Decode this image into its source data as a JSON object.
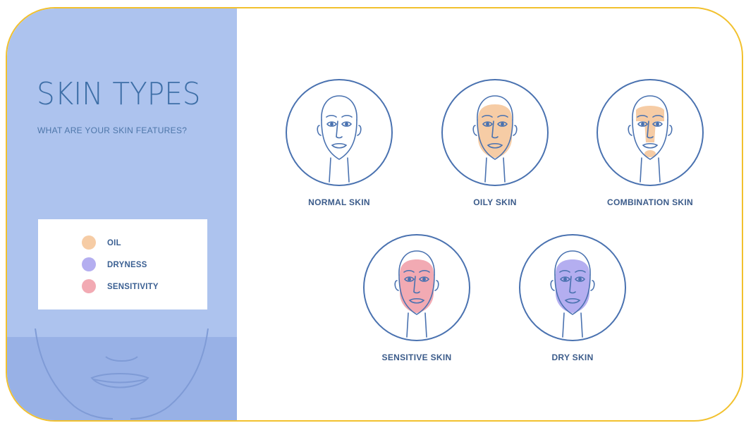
{
  "header": {
    "title": "SKIN TYPES",
    "subtitle": "WHAT ARE YOUR SKIN FEATURES?"
  },
  "legend": {
    "items": [
      {
        "label": "OIL",
        "color": "#f6cca5"
      },
      {
        "label": "DRYNESS",
        "color": "#b4aef0"
      },
      {
        "label": "SENSITIVITY",
        "color": "#f2aab3"
      }
    ]
  },
  "colors": {
    "panel": "#adc3ee",
    "accent_line": "#4a72b0",
    "frame_border": "#f2c12e"
  },
  "faces": [
    {
      "id": "normal",
      "label": "NORMAL SKIN",
      "icon": "face-icon"
    },
    {
      "id": "oily",
      "label": "OILY SKIN",
      "icon": "face-icon"
    },
    {
      "id": "combination",
      "label": "COMBINATION SKIN",
      "icon": "face-icon"
    },
    {
      "id": "sensitive",
      "label": "SENSITIVE SKIN",
      "icon": "face-icon"
    },
    {
      "id": "dry",
      "label": "DRY SKIN",
      "icon": "face-icon"
    }
  ]
}
